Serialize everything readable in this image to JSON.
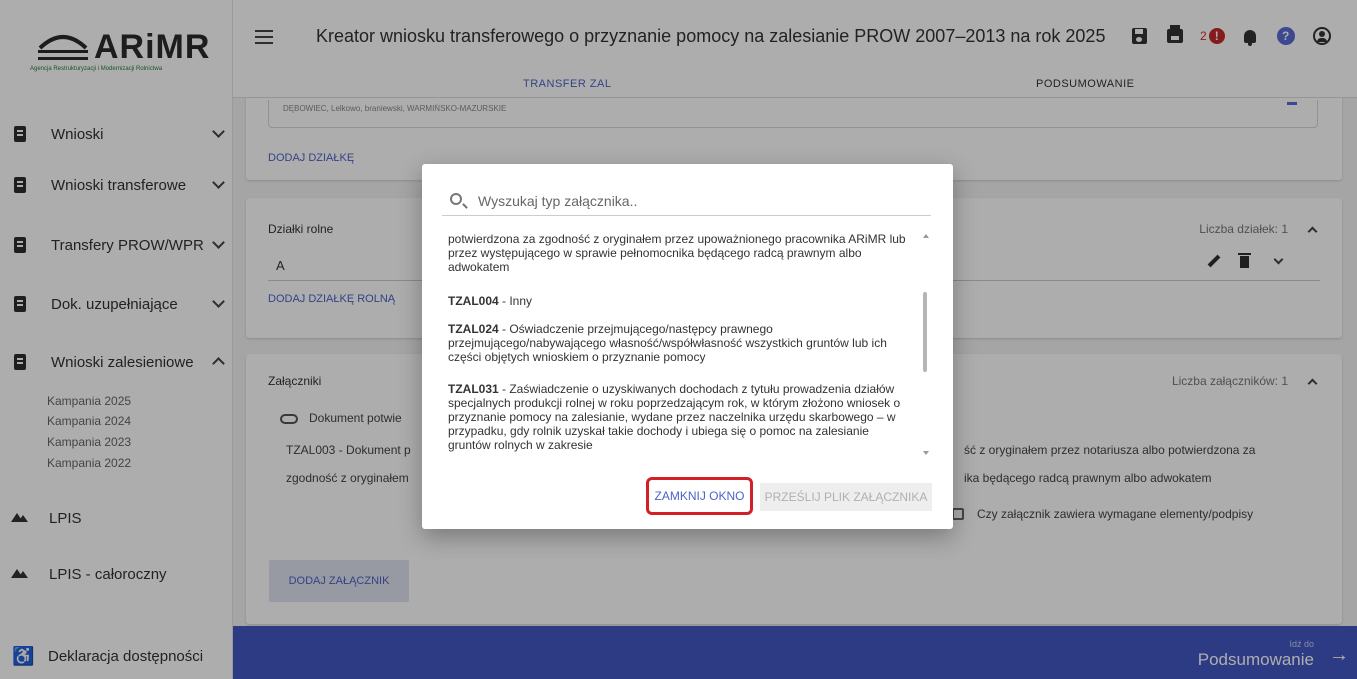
{
  "app": {
    "logo_text": "ARiMR",
    "logo_subtitle": "Agencja Restrukturyzacji i Modernizacji Rolnictwa",
    "title": "Kreator wniosku transferowego o przyznanie pomocy na zalesianie PROW 2007–2013 na rok 2025",
    "error_count": "2"
  },
  "tabs": {
    "transfer": "TRANSFER ZAL",
    "summary": "PODSUMOWANIE"
  },
  "sidebar": {
    "items": [
      {
        "label": "Wnioski"
      },
      {
        "label": "Wnioski transferowe"
      },
      {
        "label": "Transfery PROW/WPR"
      },
      {
        "label": "Dok. uzupełniające"
      },
      {
        "label": "Wnioski zalesieniowe"
      },
      {
        "label": "LPIS"
      },
      {
        "label": "LPIS - całoroczny"
      },
      {
        "label": "Deklaracja dostępności"
      }
    ],
    "campaigns": [
      "Kampania 2025",
      "Kampania 2024",
      "Kampania 2023",
      "Kampania 2022"
    ]
  },
  "main": {
    "address": "DĘBOWIEC, Lelkowo, braniewski, WARMIŃSKO-MAZURSKIE",
    "add_plot": "DODAJ DZIAŁKĘ",
    "plots_title": "Działki rolne",
    "plots_count": "Liczba działek: 1",
    "plot_row": "A",
    "add_ag_plot": "DODAJ DZIAŁKĘ ROLNĄ",
    "att_title": "Załączniki",
    "att_count": "Liczba załączników: 1",
    "att_doc": "Dokument potwie",
    "att_line1_left": "TZAL003 - Dokument p",
    "att_line1_right": "ść z oryginałem przez notariusza albo potwierdzona za",
    "att_line2_left": "zgodność z oryginałem",
    "att_line2_right": "ika będącego radcą prawnym albo adwokatem",
    "att_checkbox": "Czy załącznik zawiera wymagane elementy/podpisy",
    "add_attachment": "DODAJ ZAŁĄCZNIK"
  },
  "footer": {
    "sub": "Idź do",
    "main": "Podsumowanie"
  },
  "modal": {
    "search_placeholder": "Wyszukaj typ załącznika..",
    "items": [
      {
        "code": "",
        "text": "potwierdzona za zgodność z oryginałem przez upoważnionego pracownika ARiMR lub przez występującego w sprawie pełnomocnika będącego radcą prawnym albo adwokatem"
      },
      {
        "code": "TZAL004",
        "text": " - Inny"
      },
      {
        "code": "TZAL024",
        "text": " - Oświadczenie przejmującego/następcy prawnego przejmującego/nabywającego własność/współwłasność wszystkich gruntów lub ich części objętych wnioskiem o przyznanie pomocy"
      },
      {
        "code": "TZAL031",
        "text": " - Zaświadczenie o uzyskiwanych dochodach z tytułu prowadzenia działów specjalnych produkcji rolnej w roku poprzedzającym rok, w którym złożono wniosek o przyznanie pomocy na zalesianie, wydane przez naczelnika urzędu skarbowego – w przypadku, gdy rolnik uzyskał takie dochody i ubiega się o pomoc na zalesianie gruntów rolnych w zakresie"
      }
    ],
    "close_label": "ZAMKNIJ OKNO",
    "upload_label": "PRZEŚLIJ PLIK ZAŁĄCZNIKA"
  },
  "colors": {
    "primary": "#4157c1",
    "link": "#4d63c9",
    "highlight": "#d31f26",
    "error": "#c62828"
  }
}
